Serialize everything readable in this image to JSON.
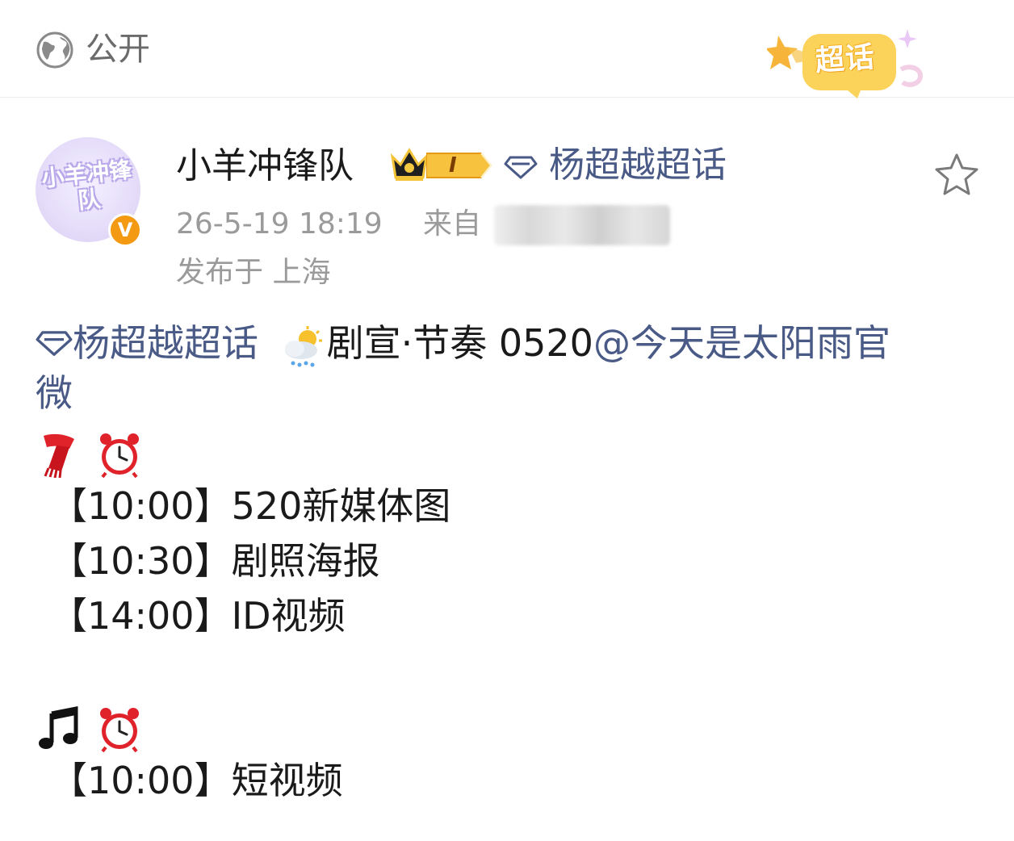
{
  "topbar": {
    "visibility_label": "公开",
    "supertopic_badge": "超话"
  },
  "post": {
    "author": {
      "name": "小羊冲锋队",
      "avatar_text": "小羊冲锋队",
      "verified_mark": "V",
      "level": "I"
    },
    "header_topic": "杨超越超话",
    "time": "26-5-19 18:19",
    "source_prefix": "来自",
    "location": "发布于 上海",
    "body": {
      "topic_link": "杨超越超话",
      "text_after_topic": "剧宣·节奏 0520",
      "mention_line1": "@今天是太阳雨官",
      "mention_line2": "微",
      "group1": [
        {
          "time": "【10:00】",
          "item": "520新媒体图"
        },
        {
          "time": "【10:30】",
          "item": "剧照海报"
        },
        {
          "time": "【14:00】",
          "item": "ID视频"
        }
      ],
      "group2": [
        {
          "time": "【10:00】",
          "item": "短视频"
        }
      ]
    }
  },
  "colors": {
    "link": "#4a5a86",
    "meta": "#9a9a9a",
    "verified": "#f39a12"
  },
  "icons": [
    "globe-icon",
    "star-outline-icon",
    "crown-icon",
    "diamond-topic-icon",
    "scarf-emoji-icon",
    "alarm-clock-emoji-icon",
    "music-note-emoji-icon",
    "sun-rain-emoji-icon"
  ]
}
